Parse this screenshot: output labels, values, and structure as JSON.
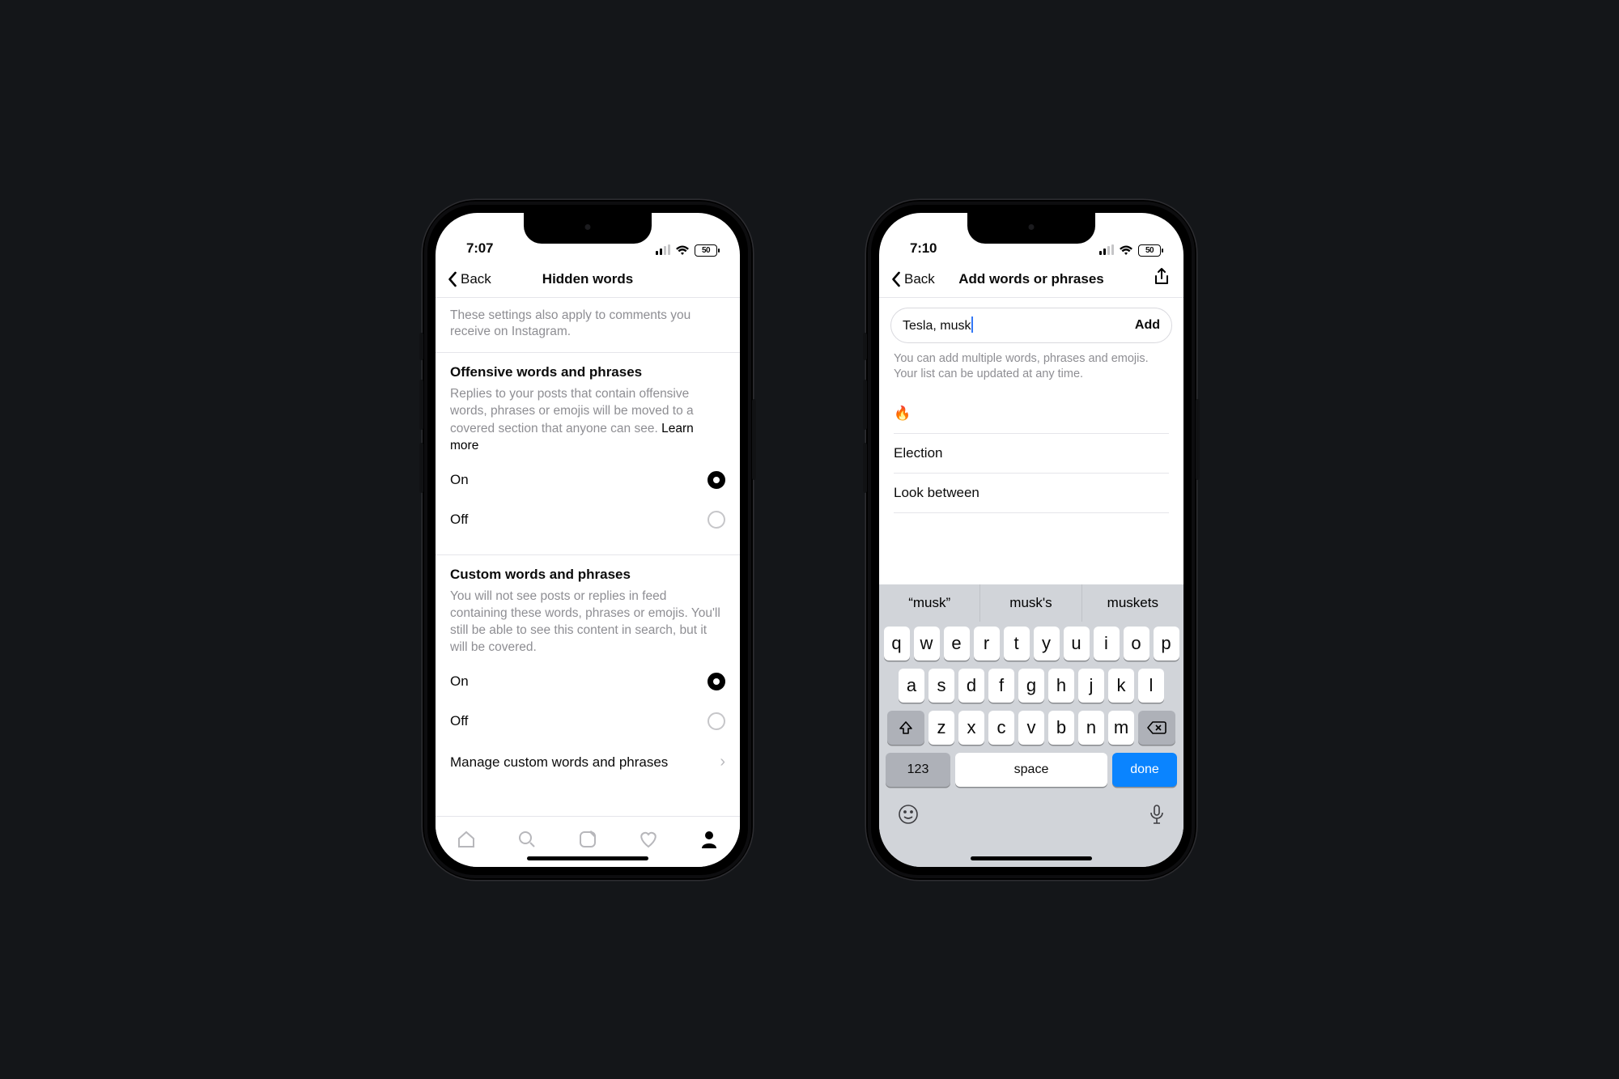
{
  "status": {
    "battery": "50"
  },
  "left": {
    "time": "7:07",
    "back": "Back",
    "title": "Hidden words",
    "intro": "These settings also apply to comments you receive on Instagram.",
    "s1": {
      "heading": "Offensive words and phrases",
      "body": "Replies to your posts that contain offensive words, phrases or emojis will be moved to a covered section that anyone can see. ",
      "more": "Learn more"
    },
    "on": "On",
    "off": "Off",
    "s2": {
      "heading": "Custom words and phrases",
      "body": "You will not see posts or replies in feed containing these words, phrases or emojis. You'll still be able to see this content in search, but it will be covered."
    },
    "manage": "Manage custom words and phrases"
  },
  "right": {
    "time": "7:10",
    "back": "Back",
    "title": "Add words or phrases",
    "input": "Tesla, musk",
    "add": "Add",
    "hint": "You can add multiple words, phrases and emojis. Your list can be updated at any time.",
    "items": [
      "🔥",
      "Election",
      "Look between"
    ],
    "suggest": [
      "“musk”",
      "musk's",
      "muskets"
    ],
    "kb_rows": [
      [
        "q",
        "w",
        "e",
        "r",
        "t",
        "y",
        "u",
        "i",
        "o",
        "p"
      ],
      [
        "a",
        "s",
        "d",
        "f",
        "g",
        "h",
        "j",
        "k",
        "l"
      ],
      [
        "z",
        "x",
        "c",
        "v",
        "b",
        "n",
        "m"
      ]
    ],
    "k123": "123",
    "space": "space",
    "done": "done"
  }
}
